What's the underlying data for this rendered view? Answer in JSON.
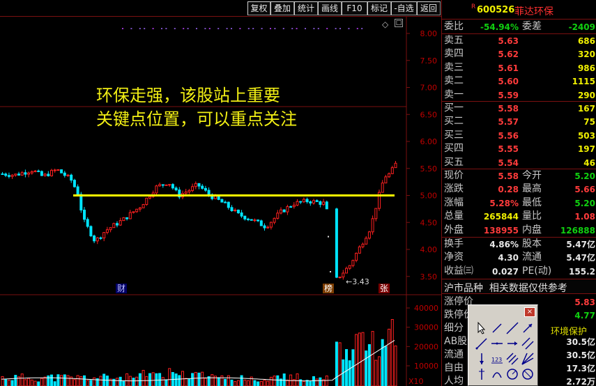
{
  "toolbar": {
    "buttons": [
      {
        "label": "复权"
      },
      {
        "label": "叠加"
      },
      {
        "label": "统计"
      },
      {
        "label": "画线"
      },
      {
        "label": "F10"
      },
      {
        "label": "标记"
      },
      {
        "label": "-自选"
      },
      {
        "label": "返回"
      }
    ]
  },
  "chart": {
    "annotation_line1": "环保走强，该股站上重要",
    "annotation_line2": "关键点位置，可以重点关注",
    "low_label": "3.43",
    "mark_cai": "财",
    "mark_bang": "榜",
    "mark_zhang": "张",
    "support_price": 5.0,
    "colors": {
      "up": "#ff2020",
      "down": "#00e5ff",
      "support": "#ffff00",
      "grid": "#7a1010"
    }
  },
  "chart_data": {
    "type": "candlestick",
    "y_axis_ticks": [
      "8.00",
      "7.50",
      "7.00",
      "6.50",
      "6.00",
      "5.50",
      "5.00",
      "4.50",
      "4.00",
      "3.50"
    ],
    "ylim": [
      3.4,
      8.1
    ],
    "volume_ticks": [
      "40000",
      "30000",
      "20000",
      "10000"
    ],
    "volume_unit": "X10",
    "support_level": 5.0,
    "low_marker": 3.43
  },
  "quote": {
    "r_mark": "R",
    "code": "600526",
    "name": "菲达环保",
    "weibi_label": "委比",
    "weibi_value": "-54.94%",
    "weicha_label": "委差",
    "weicha_value": "-2409",
    "sell": [
      {
        "label": "卖五",
        "price": "5.63",
        "vol": "686"
      },
      {
        "label": "卖四",
        "price": "5.62",
        "vol": "320"
      },
      {
        "label": "卖三",
        "price": "5.61",
        "vol": "986"
      },
      {
        "label": "卖二",
        "price": "5.60",
        "vol": "1115"
      },
      {
        "label": "卖一",
        "price": "5.59",
        "vol": "290"
      }
    ],
    "buy": [
      {
        "label": "买一",
        "price": "5.58",
        "vol": "167"
      },
      {
        "label": "买二",
        "price": "5.57",
        "vol": "75"
      },
      {
        "label": "买三",
        "price": "5.56",
        "vol": "503"
      },
      {
        "label": "买四",
        "price": "5.55",
        "vol": "197"
      },
      {
        "label": "买五",
        "price": "5.54",
        "vol": "46"
      }
    ],
    "stats": [
      {
        "l1": "现价",
        "v1": "5.58",
        "c1": "red",
        "l2": "今开",
        "v2": "5.20",
        "c2": "green"
      },
      {
        "l1": "涨跌",
        "v1": "0.28",
        "c1": "red",
        "l2": "最高",
        "v2": "5.66",
        "c2": "red"
      },
      {
        "l1": "涨幅",
        "v1": "5.28%",
        "c1": "red",
        "l2": "最低",
        "v2": "5.20",
        "c2": "green"
      },
      {
        "l1": "总量",
        "v1": "265844",
        "c1": "yellow",
        "l2": "量比",
        "v2": "1.08",
        "c2": "red"
      },
      {
        "l1": "外盘",
        "v1": "138955",
        "c1": "red",
        "l2": "内盘",
        "v2": "126888",
        "c2": "green"
      }
    ],
    "fundamentals": [
      {
        "l1": "换手",
        "v1": "4.86%",
        "l2": "股本",
        "v2": "5.47亿"
      },
      {
        "l1": "净资",
        "v1": "4.30",
        "l2": "流通",
        "v2": "5.47亿"
      },
      {
        "l1": "收益㈢",
        "v1": "0.027",
        "l2": "PE(动)",
        "v2": "155.2"
      }
    ],
    "sh_label": "沪市品种",
    "sh_note": "相关数据仅供参考",
    "limit_up_label": "涨停价",
    "limit_up_value": "5.83",
    "limit_down_label": "跌停价",
    "limit_down_value": "4.77",
    "segment_label": "细分",
    "industry": "环境保护",
    "ab_label": "AB股",
    "ab_value": "30.5亿",
    "circ_label": "流通",
    "circ_value": "30.5亿",
    "free_label": "自由",
    "free_value": "17.3亿",
    "per_label": "人均",
    "per_value": "2.72万"
  },
  "toolbox": {
    "close": "×",
    "text_tool_label": "123"
  }
}
